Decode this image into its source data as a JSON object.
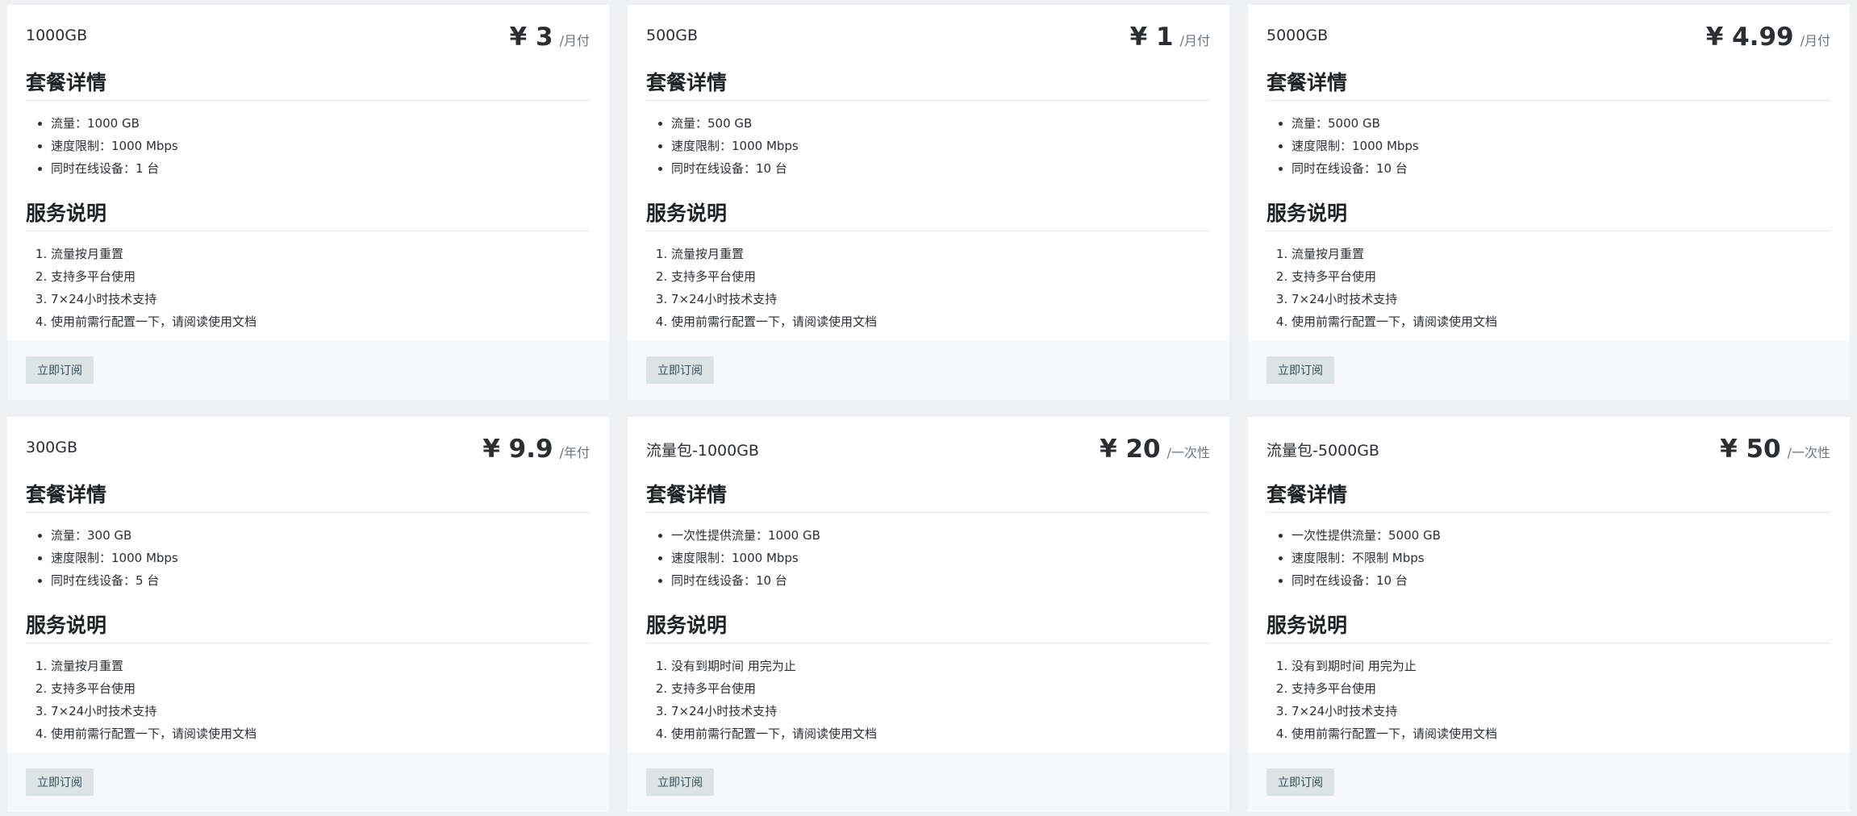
{
  "subscribe_label": "立即订阅",
  "section_details_title": "套餐详情",
  "section_service_title": "服务说明",
  "plans": [
    {
      "name": "1000GB",
      "price": "¥ 3",
      "period": "/月付",
      "details": [
        "流量：1000 GB",
        "速度限制：1000 Mbps",
        "同时在线设备：1 台"
      ],
      "service": [
        "流量按月重置",
        "支持多平台使用",
        "7×24小时技术支持",
        "使用前需行配置一下，请阅读使用文档"
      ]
    },
    {
      "name": "500GB",
      "price": "¥ 1",
      "period": "/月付",
      "details": [
        "流量：500 GB",
        "速度限制：1000 Mbps",
        "同时在线设备：10 台"
      ],
      "service": [
        "流量按月重置",
        "支持多平台使用",
        "7×24小时技术支持",
        "使用前需行配置一下，请阅读使用文档"
      ]
    },
    {
      "name": "5000GB",
      "price": "¥ 4.99",
      "period": "/月付",
      "details": [
        "流量：5000 GB",
        "速度限制：1000 Mbps",
        "同时在线设备：10 台"
      ],
      "service": [
        "流量按月重置",
        "支持多平台使用",
        "7×24小时技术支持",
        "使用前需行配置一下，请阅读使用文档"
      ]
    },
    {
      "name": "300GB",
      "price": "¥ 9.9",
      "period": "/年付",
      "details": [
        "流量：300 GB",
        "速度限制：1000 Mbps",
        "同时在线设备：5 台"
      ],
      "service": [
        "流量按月重置",
        "支持多平台使用",
        "7×24小时技术支持",
        "使用前需行配置一下，请阅读使用文档"
      ]
    },
    {
      "name": "流量包-1000GB",
      "price": "¥ 20",
      "period": "/一次性",
      "details": [
        "一次性提供流量：1000 GB",
        "速度限制：1000 Mbps",
        "同时在线设备：10 台"
      ],
      "service": [
        "没有到期时间 用完为止",
        "支持多平台使用",
        "7×24小时技术支持",
        "使用前需行配置一下，请阅读使用文档"
      ]
    },
    {
      "name": "流量包-5000GB",
      "price": "¥ 50",
      "period": "/一次性",
      "details": [
        "一次性提供流量：5000 GB",
        "速度限制：不限制 Mbps",
        "同时在线设备：10 台"
      ],
      "service": [
        "没有到期时间 用完为止",
        "支持多平台使用",
        "7×24小时技术支持",
        "使用前需行配置一下，请阅读使用文档"
      ]
    }
  ]
}
